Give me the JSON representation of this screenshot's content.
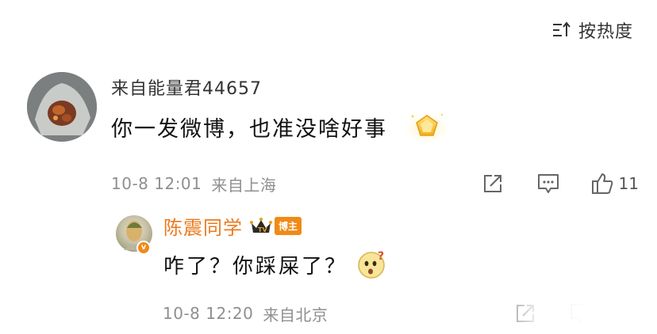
{
  "sort": {
    "label": "按热度",
    "icon": "sort-icon"
  },
  "comment": {
    "author": "来自能量君44657",
    "text": "你一发微博，也准没啥好事",
    "badge_icon": "gold-pentagon-badge-icon",
    "timestamp": "10-8 12:01",
    "location": "来自上海",
    "like_count": "11"
  },
  "reply": {
    "author": "陈震同学",
    "tag": "博主",
    "text": "咋了？你踩屎了？",
    "emoji_icon": "thinking-face-emoji-icon",
    "timestamp": "10-8 12:20",
    "location": "来自北京"
  },
  "colors": {
    "author_orange": "#eb7a1e",
    "meta_gray": "#8f8f8f",
    "badge_orange": "#f08a17"
  }
}
